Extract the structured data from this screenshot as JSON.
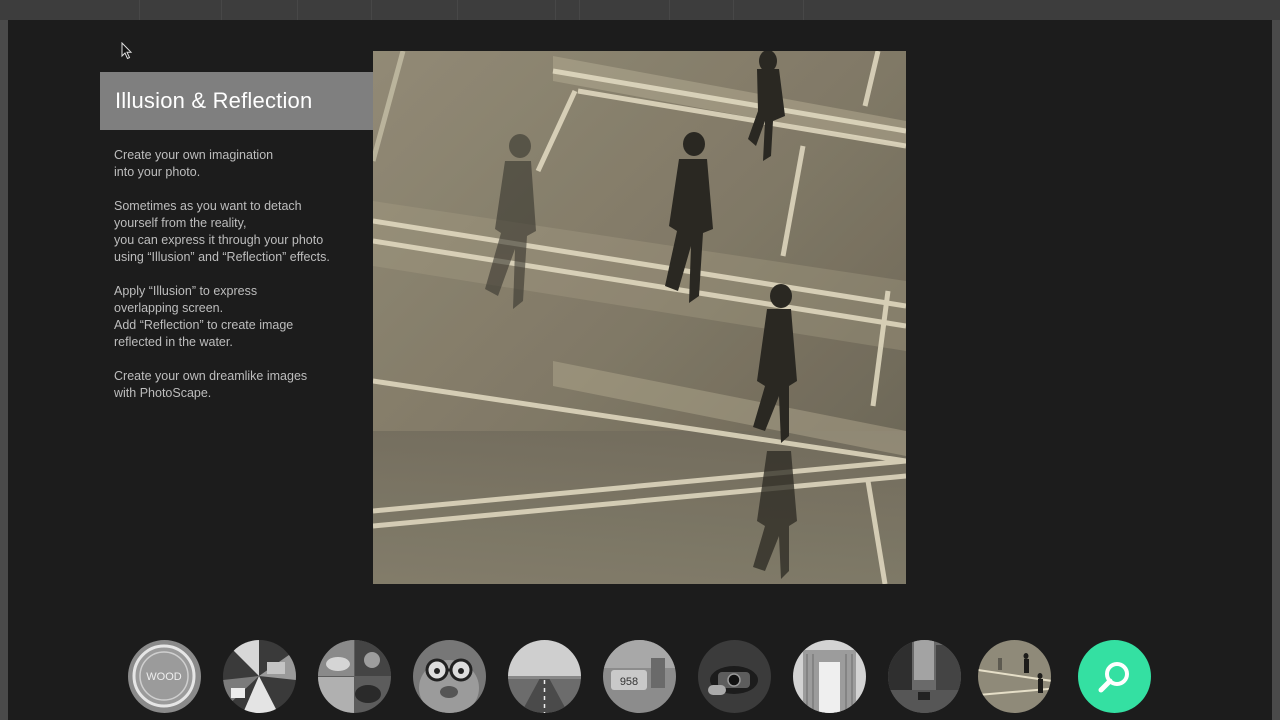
{
  "feature": {
    "title": "Illusion & Reflection",
    "paragraphs": [
      "Create your own imagination\ninto your photo.",
      "Sometimes as you want to detach\nyourself from the reality,\nyou can express it through your photo\nusing “Illusion” and “Reflection” effects.",
      "Apply “Illusion” to express\noverlapping screen.\nAdd “Reflection” to create image\nreflected in the water.",
      "Create your own dreamlike images\nwith PhotoScape."
    ]
  },
  "thumbnails": [
    {
      "icon": "wood-sign-thumbnail",
      "text": "WOOD"
    },
    {
      "icon": "collage-thumbnail"
    },
    {
      "icon": "food-collage-thumbnail"
    },
    {
      "icon": "glasses-character-thumbnail"
    },
    {
      "icon": "road-thumbnail"
    },
    {
      "icon": "sign-thumbnail",
      "text": "958"
    },
    {
      "icon": "camera-hands-thumbnail"
    },
    {
      "icon": "building-arch-thumbnail"
    },
    {
      "icon": "city-street-thumbnail"
    },
    {
      "icon": "illusion-reflection-thumbnail"
    }
  ],
  "search": {
    "icon": "search-icon",
    "color": "#34e0a2"
  }
}
